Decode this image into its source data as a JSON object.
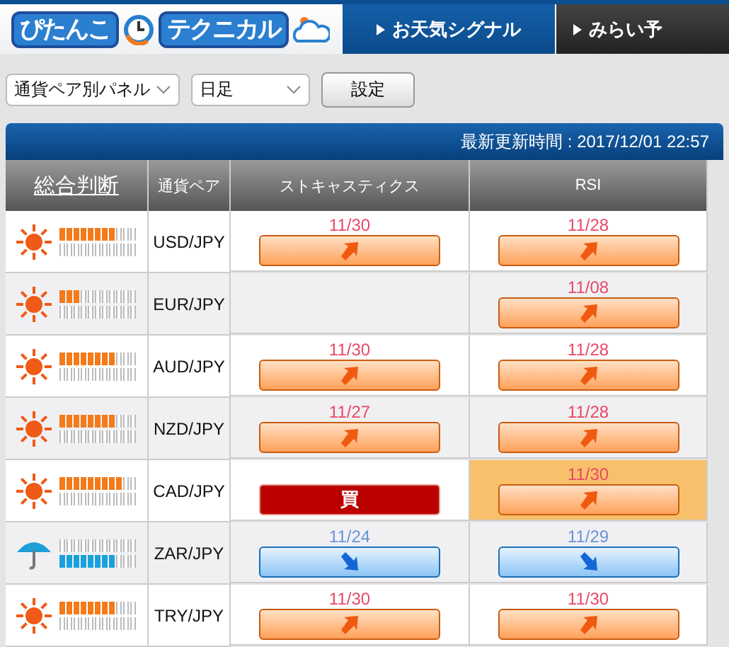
{
  "header": {
    "logo_left": "ぴたんこ",
    "logo_right": "テクニカル",
    "tabs": [
      {
        "label": "お天気シグナル",
        "selected": true
      },
      {
        "label": "みらい予",
        "selected": false
      }
    ]
  },
  "controls": {
    "view_select": "通貨ペア別パネル",
    "period_select": "日足",
    "apply_button": "設定"
  },
  "update_bar": {
    "text": "最新更新時間 : 2017/12/01 22:57"
  },
  "table": {
    "columns": [
      "総合判断",
      "通貨ペア",
      "ストキャスティクス",
      "RSI"
    ],
    "rows": [
      {
        "kind": "sun",
        "buy_meter": {
          "level": 0.727
        },
        "sell_meter": {
          "level": 0
        },
        "pair": "USD/JPY",
        "signals": [
          {
            "kind": "up",
            "date": "11/30",
            "highlighted": false
          },
          {
            "kind": "up",
            "date": "11/28",
            "highlighted": false
          }
        ]
      },
      {
        "kind": "sun",
        "buy_meter": {
          "level": 0.273
        },
        "sell_meter": {
          "level": 0
        },
        "pair": "EUR/JPY",
        "signals": [
          {
            "kind": "none",
            "highlighted": false
          },
          {
            "kind": "up",
            "date": "11/08",
            "highlighted": false
          }
        ]
      },
      {
        "kind": "sun",
        "buy_meter": {
          "level": 0.727
        },
        "sell_meter": {
          "level": 0
        },
        "pair": "AUD/JPY",
        "signals": [
          {
            "kind": "up",
            "date": "11/30",
            "highlighted": false
          },
          {
            "kind": "up",
            "date": "11/28",
            "highlighted": false
          }
        ]
      },
      {
        "kind": "sun",
        "buy_meter": {
          "level": 0.727
        },
        "sell_meter": {
          "level": 0
        },
        "pair": "NZD/JPY",
        "signals": [
          {
            "kind": "up",
            "date": "11/27",
            "highlighted": false
          },
          {
            "kind": "up",
            "date": "11/28",
            "highlighted": false
          }
        ]
      },
      {
        "kind": "sun",
        "buy_meter": {
          "level": 0.818
        },
        "sell_meter": {
          "level": 0
        },
        "pair": "CAD/JPY",
        "signals": [
          {
            "kind": "buy",
            "label": "買",
            "highlighted": false
          },
          {
            "kind": "up",
            "date": "11/30",
            "highlighted": true
          }
        ]
      },
      {
        "kind": "rain",
        "buy_meter": {
          "level": 0
        },
        "sell_meter": {
          "level": 0.727
        },
        "pair": "ZAR/JPY",
        "signals": [
          {
            "kind": "down",
            "date": "11/24",
            "highlighted": false
          },
          {
            "kind": "down",
            "date": "11/29",
            "highlighted": false
          }
        ]
      },
      {
        "kind": "sun",
        "buy_meter": {
          "level": 0.727
        },
        "sell_meter": {
          "level": 0
        },
        "pair": "TRY/JPY",
        "signals": [
          {
            "kind": "up",
            "date": "11/30",
            "highlighted": false
          },
          {
            "kind": "up",
            "date": "11/30",
            "highlighted": false
          }
        ]
      }
    ]
  }
}
